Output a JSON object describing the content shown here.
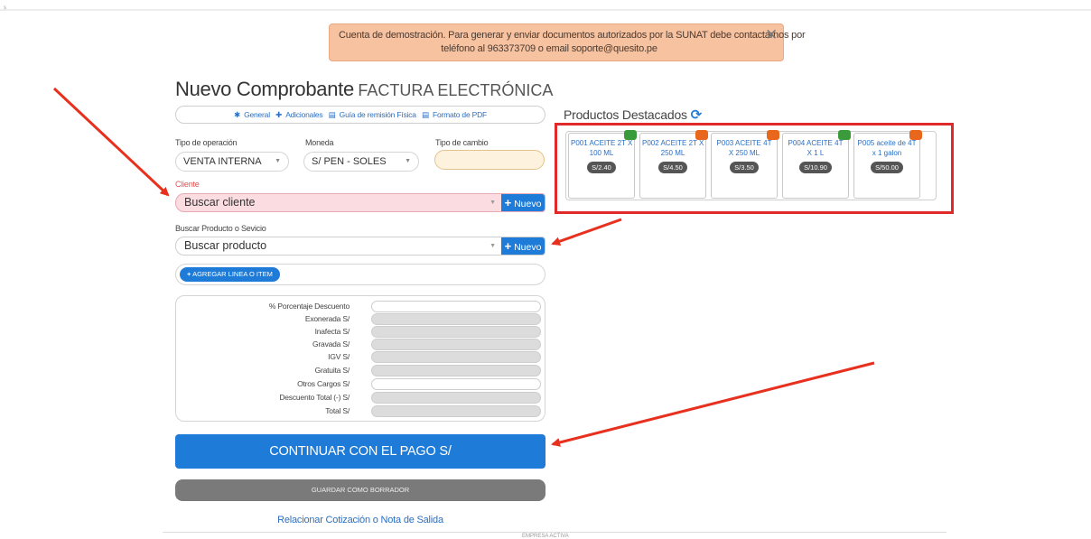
{
  "alert": {
    "line1": "Cuenta de demostración. Para generar y enviar documentos autorizados por la SUNAT debe contactarnos por",
    "line2": "teléfono al 963373709 o email soporte@quesito.pe",
    "close_glyph": "✕"
  },
  "page": {
    "title": "Nuevo Comprobante",
    "subtitle": "FACTURA ELECTRÓNICA"
  },
  "tabs": [
    {
      "icon": "asterisk-icon",
      "glyph": "✱",
      "label": "General"
    },
    {
      "icon": "plus-circle-icon",
      "glyph": "✚",
      "label": "Adicionales"
    },
    {
      "icon": "document-icon",
      "glyph": "▤",
      "label": "Guía de remisión Física"
    },
    {
      "icon": "document-icon",
      "glyph": "▤",
      "label": "Formato de PDF"
    }
  ],
  "form": {
    "tipo_operacion": {
      "label": "Tipo de operación",
      "value": "VENTA INTERNA"
    },
    "moneda": {
      "label": "Moneda",
      "value": "S/ PEN - SOLES"
    },
    "tipo_cambio": {
      "label": "Tipo de cambio",
      "value": ""
    },
    "cliente": {
      "label": "Cliente",
      "placeholder": "Buscar cliente",
      "new_label": "Nuevo"
    },
    "producto": {
      "label": "Buscar Producto o Sevicio",
      "placeholder": "Buscar producto",
      "new_label": "Nuevo"
    },
    "agregar_label": "AGREGAR LINEA O ITEM",
    "caret": "▼"
  },
  "totals": [
    {
      "label": "% Porcentaje Descuento",
      "editable": true
    },
    {
      "label": "Exonerada S/",
      "editable": false
    },
    {
      "label": "Inafecta S/",
      "editable": false
    },
    {
      "label": "Gravada S/",
      "editable": false
    },
    {
      "label": "IGV S/",
      "editable": false
    },
    {
      "label": "Gratuita S/",
      "editable": false
    },
    {
      "label": "Otros Cargos S/",
      "editable": true
    },
    {
      "label": "Descuento Total (-) S/",
      "editable": false
    },
    {
      "label": "Total S/",
      "editable": false
    }
  ],
  "actions": {
    "pay_label": "CONTINUAR CON EL PAGO S/",
    "draft_label": "GUARDAR COMO BORRADOR",
    "relacionar_label": "Relacionar Cotización o Nota de Salida"
  },
  "featured": {
    "title": "Productos Destacados",
    "refresh_glyph": "⟳",
    "products": [
      {
        "line1": "P001 ACEITE 2T X",
        "line2": "100 ML",
        "price": "S/2.40",
        "badge_color": "#3a9b3a"
      },
      {
        "line1": "P002 ACEITE 2T X",
        "line2": "250 ML",
        "price": "S/4.50",
        "badge_color": "#e8671c"
      },
      {
        "line1": "P003 ACEITE 4T",
        "line2": "X 250 ML",
        "price": "S/3.50",
        "badge_color": "#e8671c"
      },
      {
        "line1": "P004 ACEITE 4T",
        "line2": "X 1 L",
        "price": "S/10.90",
        "badge_color": "#3a9b3a"
      },
      {
        "line1": "P005 aceite de 4T",
        "line2": "x 1 galon",
        "price": "S/50.00",
        "badge_color": "#e8671c"
      }
    ]
  },
  "footer": {
    "text": "EMPRESA ACTIVA"
  },
  "colors": {
    "primary": "#1f7bd8",
    "alert_bg": "#f7c2a0",
    "highlight": "#e02a2a",
    "client_bg": "#fbdce1"
  }
}
